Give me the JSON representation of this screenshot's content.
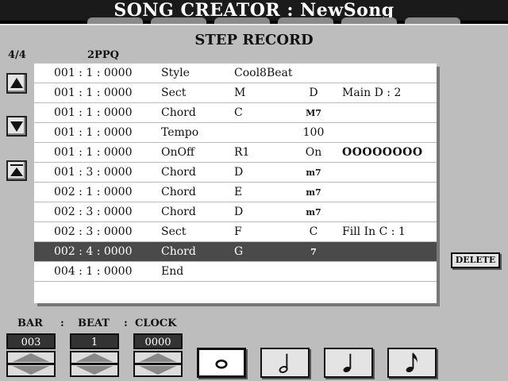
{
  "header": {
    "title": "SONG CREATOR : NewSong"
  },
  "screen": {
    "heading": "STEP RECORD",
    "time_signature": "4/4",
    "resolution": "2PPQ"
  },
  "events": [
    {
      "time": "001 : 1 : 0000",
      "type": "Style",
      "v1": "Cool8Beat",
      "v2": "",
      "v3": ""
    },
    {
      "time": "001 : 1 : 0000",
      "type": "Sect",
      "v1": "M",
      "v2": "D",
      "v3": "Main D   : 2"
    },
    {
      "time": "001 : 1 : 0000",
      "type": "Chord",
      "v1": "C",
      "v2": "M7",
      "v3": ""
    },
    {
      "time": "001 : 1 : 0000",
      "type": "Tempo",
      "v1": "",
      "v2": "100",
      "v3": ""
    },
    {
      "time": "001 : 1 : 0000",
      "type": "OnOff",
      "v1": "R1",
      "v2": "On",
      "v3": "OOOOOOOO"
    },
    {
      "time": "001 : 3 : 0000",
      "type": "Chord",
      "v1": "D",
      "v2": "m7",
      "v3": ""
    },
    {
      "time": "002 : 1 : 0000",
      "type": "Chord",
      "v1": "E",
      "v2": "m7",
      "v3": ""
    },
    {
      "time": "002 : 3 : 0000",
      "type": "Chord",
      "v1": "D",
      "v2": "m7",
      "v3": ""
    },
    {
      "time": "002 : 3 : 0000",
      "type": "Sect",
      "v1": "F",
      "v2": "C",
      "v3": "Fill In C  : 1"
    },
    {
      "time": "002 : 4 : 0000",
      "type": "Chord",
      "v1": "G",
      "v2": "7",
      "v3": ""
    },
    {
      "time": "004 : 1 : 0000",
      "type": "End",
      "v1": "",
      "v2": "",
      "v3": ""
    }
  ],
  "selected_index": 9,
  "delete_label": "DELETE",
  "position": {
    "bar_label": "BAR",
    "beat_label": "BEAT",
    "clock_label": "CLOCK",
    "sep1": ":",
    "sep2": ":",
    "bar": "003",
    "beat": "1",
    "clock": "0000"
  },
  "icons": {
    "up": "arrow-up-icon",
    "down": "arrow-down-icon",
    "top": "arrow-top-icon",
    "notes": [
      "whole-note-icon",
      "half-note-icon",
      "quarter-note-icon",
      "eighth-note-icon"
    ]
  },
  "colors": {
    "background": "#bdbdbd",
    "list": "#ffffff",
    "selected_row": "#4a4a4a",
    "title_bar": "#1a1a1a"
  }
}
